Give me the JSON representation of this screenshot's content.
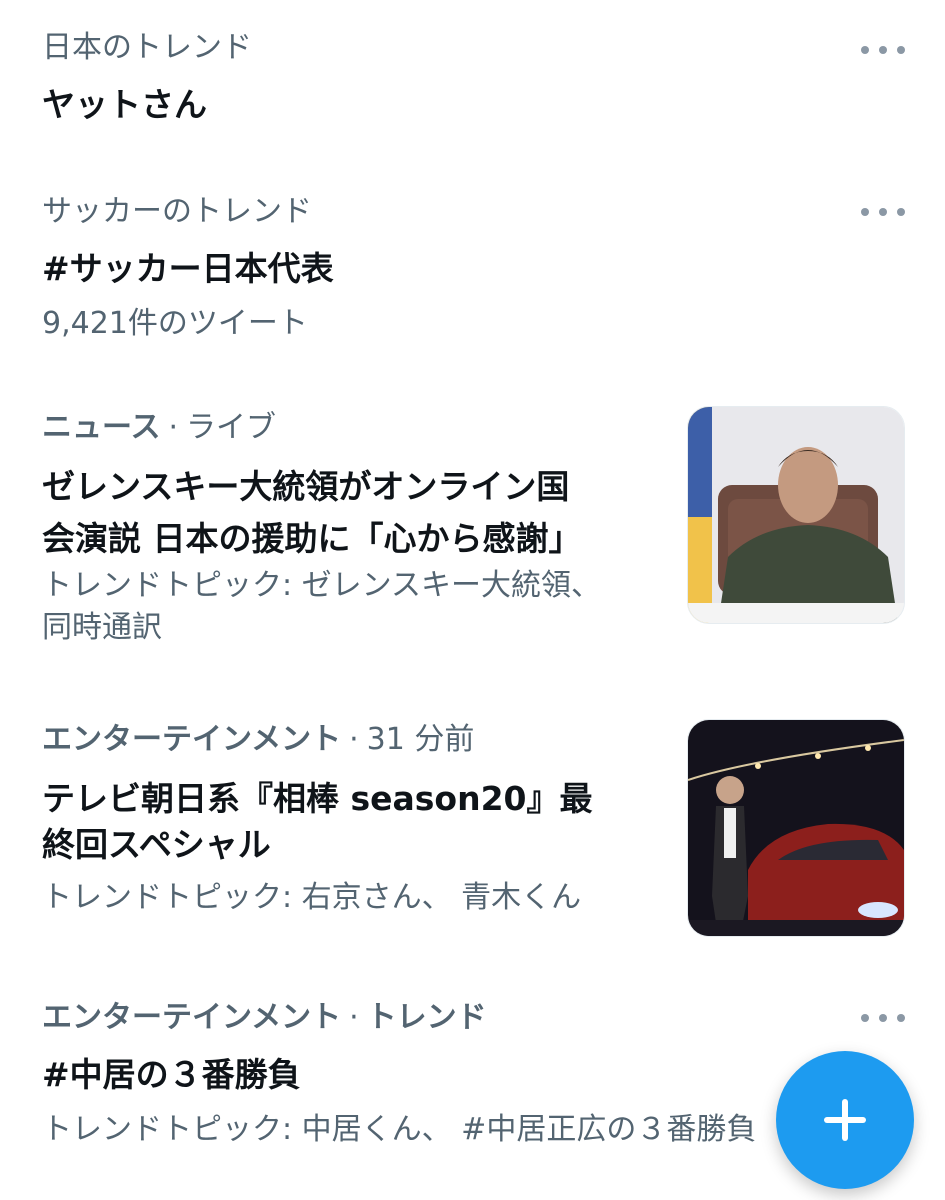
{
  "trends": [
    {
      "context": "日本のトレンド",
      "title": "ヤットさん"
    },
    {
      "context": "サッカーのトレンド",
      "title": "#サッカー日本代表",
      "count": "9,421件のツイート"
    },
    {
      "category": "ニュース",
      "separator": "·",
      "status": "ライブ",
      "title_line1": "ゼレンスキー大統領がオンライン国",
      "title_line2": "会演説 日本の援助に「心から感謝」",
      "topics_line1": "トレンドトピック: ゼレンスキー大統領、",
      "topics_line2": "同時通訳"
    },
    {
      "category": "エンターテインメント",
      "separator": "·",
      "status": "31 分前",
      "title_line1": "テレビ朝日系『相棒 season20』最",
      "title_line2": "終回スペシャル",
      "topics": "トレンドトピック: 右京さん、 青木くん"
    },
    {
      "category": "エンターテインメント",
      "separator": "·",
      "status": "トレンド",
      "title": "#中居の３番勝負",
      "topics": "トレンドトピック: 中居くん、 #中居正広の３番勝負"
    }
  ],
  "colors": {
    "accent": "#1d9bf0",
    "secondary_text": "#536471",
    "primary_text": "#0f1419"
  },
  "icons": {
    "more": "more-horizontal-icon",
    "compose": "plus-icon"
  }
}
